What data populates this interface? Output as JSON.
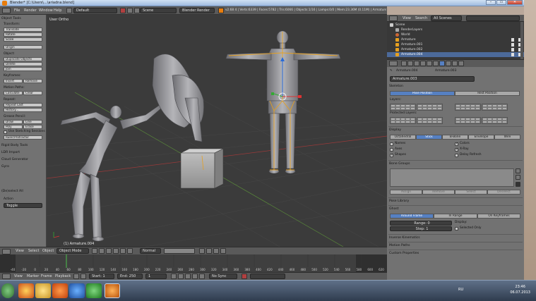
{
  "title_bar": {
    "title": "Blender* [C:\\Users\\...\\ariadna.blend]"
  },
  "info_header": {
    "menus": [
      "File",
      "Render",
      "Window",
      "Help"
    ],
    "layout": "Default",
    "scene": "Scene",
    "engine": "Blender Render",
    "stats": "v2.68 4 | Verts:6339 | Faces:5782 | Tris:6066 | Objects:1/16 | Lamps:0/0 | Mem:23.36M (0.11M) | Armature.004"
  },
  "toolshelf": {
    "header": "Object Tools",
    "transform_label": "Transform:",
    "translate": "Translate",
    "rotate": "Rotate",
    "scale": "Scale",
    "origin": "Origin",
    "object_label": "Object:",
    "duplicate": "Duplicate Objects",
    "delete": "Delete",
    "join": "Join",
    "keyframes_label": "Keyframes:",
    "insert": "Insert",
    "remove": "Remove",
    "motion_label": "Motion Paths:",
    "calculate": "Calculate",
    "clear": "Clear",
    "repeat_label": "Repeat:",
    "repeat_last": "Repeat Last",
    "history": "History...",
    "grease_label": "Grease Pencil:",
    "draw": "Draw",
    "line": "Line",
    "poly": "Poly",
    "erase": "Erase",
    "use_sketching": "Use Sketching Sessions",
    "ruler": "Ruler/Protractor",
    "rigid_body": "Rigid Body Tools",
    "ldr_import": "LDR Import",
    "cloud_gen": "Cloud Generator",
    "gyro": "Gyro",
    "deselect_all": "(De)select All",
    "action_label": "Action",
    "toggle": "Toggle"
  },
  "viewport": {
    "label": "User Ortho",
    "object_label": "(1) Armature.004"
  },
  "view3d_header": {
    "view": "View",
    "select": "Select",
    "object": "Object",
    "mode": "Object Mode",
    "pivot": "Normal"
  },
  "timeline": {
    "ticks": [
      "-40",
      "-20",
      "0",
      "20",
      "40",
      "60",
      "80",
      "100",
      "120",
      "140",
      "160",
      "180",
      "200",
      "220",
      "240",
      "260",
      "280",
      "300",
      "320",
      "340",
      "360",
      "380",
      "400",
      "420",
      "440",
      "460",
      "480",
      "500",
      "520",
      "540",
      "560",
      "580",
      "600",
      "620"
    ],
    "menus": [
      "View",
      "Marker",
      "Frame",
      "Playback"
    ],
    "start": "Start: 1",
    "end": "End: 250",
    "current": "1",
    "sync": "No Sync"
  },
  "outliner_header": {
    "view": "View",
    "search": "Search",
    "scope": "All Scenes"
  },
  "outliner": {
    "rows": [
      "Scene",
      "RenderLayers",
      "World",
      "Armature",
      "Armature.001",
      "Armature.002",
      "Armature.004"
    ]
  },
  "properties": {
    "breadcrumb_a": "Armature.004",
    "breadcrumb_b": "Armature.003",
    "datablock": "Armature.003",
    "skeleton_head": "Skeleton",
    "pose_position": "Pose Position",
    "rest_position": "Rest Position",
    "layers_label": "Layers:",
    "protected_label": "Protected Layers:",
    "display_head": "Display",
    "octahedral": "Octahedral",
    "stick": "Stick",
    "bbone": "B-Bone",
    "envelope": "Envelope",
    "wire": "Wire",
    "names": "Names",
    "colors": "Colors",
    "axes": "Axes",
    "xray": "X-Ray",
    "shapes": "Shapes",
    "delay_refresh": "Delay Refresh",
    "bone_groups_head": "Bone Groups",
    "assign": "Assign",
    "remove": "Remove",
    "select": "Select",
    "deselect": "Deselect",
    "pose_library": "Pose Library",
    "ghost_head": "Ghost",
    "around_frame": "Around Frame",
    "in_range": "In Range",
    "on_keyframes": "On Keyframes",
    "range": "Range: 0",
    "step": "Step: 1",
    "display_label": "Display:",
    "selected_only": "Selected Only",
    "inverse_kin": "Inverse Kinematics",
    "motion_paths": "Motion Paths",
    "custom_props": "Custom Properties"
  },
  "taskbar": {
    "lang": "RU",
    "time": "23:46",
    "date": "06.07.2013"
  },
  "colors": {
    "accent": "#5680c2",
    "bone_orange": "#e6a020",
    "panel_grey": "#727272",
    "viewport_bg": "#3b3b3b"
  }
}
